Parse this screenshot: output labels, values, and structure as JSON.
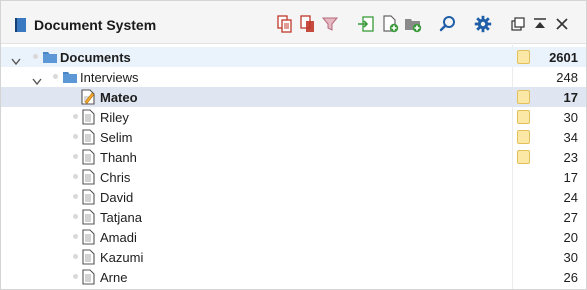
{
  "panel": {
    "title": "Document System"
  },
  "toolbar": {
    "icons": [
      "activate-documents-icon",
      "deactivate-documents-icon",
      "filter-icon",
      "import-icon",
      "new-document-icon",
      "new-document-group-icon",
      "search-icon",
      "settings-icon",
      "undock-icon",
      "maximize-icon",
      "close-icon"
    ]
  },
  "tree": {
    "root": {
      "label": "Documents",
      "count": "2601",
      "has_memo": true
    },
    "group": {
      "label": "Interviews",
      "count": "248",
      "has_memo": false
    },
    "docs": [
      {
        "label": "Mateo",
        "count": "17",
        "has_memo": true,
        "active": true
      },
      {
        "label": "Riley",
        "count": "30",
        "has_memo": true
      },
      {
        "label": "Selim",
        "count": "34",
        "has_memo": true
      },
      {
        "label": "Thanh",
        "count": "23",
        "has_memo": true
      },
      {
        "label": "Chris",
        "count": "17",
        "has_memo": false
      },
      {
        "label": "David",
        "count": "24",
        "has_memo": false
      },
      {
        "label": "Tatjana",
        "count": "27",
        "has_memo": false
      },
      {
        "label": "Amadi",
        "count": "20",
        "has_memo": false
      },
      {
        "label": "Kazumi",
        "count": "30",
        "has_memo": false
      },
      {
        "label": "Arne",
        "count": "26",
        "has_memo": false
      }
    ]
  },
  "colors": {
    "accent_red": "#c0392b",
    "accent_green": "#3a9a3a",
    "accent_blue": "#1f5fa8",
    "folder_blue": "#4a86c5",
    "memo_yellow": "#fbe7a6",
    "selected_row": "#dfe6f1"
  }
}
